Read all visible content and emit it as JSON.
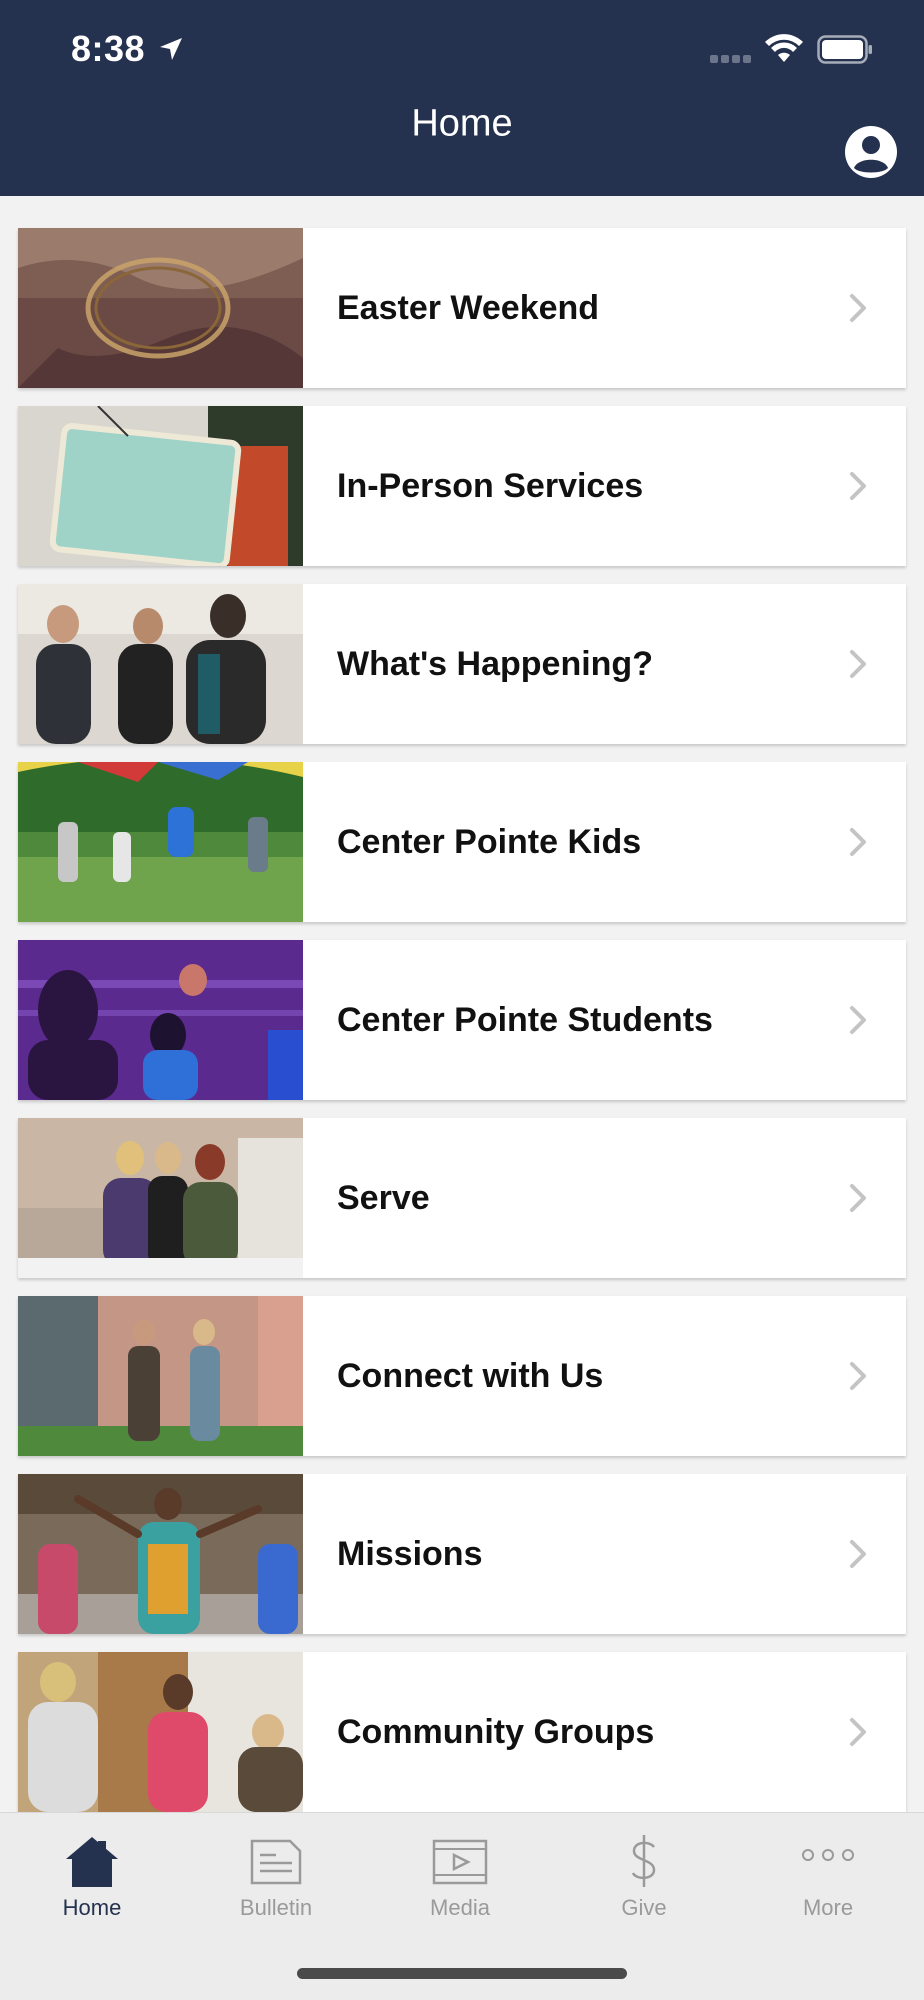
{
  "status_bar": {
    "time": "8:38"
  },
  "header": {
    "title": "Home"
  },
  "colors": {
    "header_bg": "#25324f",
    "tab_active": "#25324f",
    "tab_inactive": "#9a9a9a"
  },
  "list": {
    "items": [
      {
        "label": "Easter Weekend",
        "image": "crown-of-thorns-photo"
      },
      {
        "label": "In-Person Services",
        "image": "open-sign-photo"
      },
      {
        "label": "What's Happening?",
        "image": "women-laughing-photo"
      },
      {
        "label": "Center Pointe Kids",
        "image": "kids-parachute-photo"
      },
      {
        "label": "Center Pointe Students",
        "image": "worship-concert-photo"
      },
      {
        "label": "Serve",
        "image": "volunteers-photo"
      },
      {
        "label": "Connect with Us",
        "image": "church-entrance-photo"
      },
      {
        "label": "Missions",
        "image": "missions-dancing-photo"
      },
      {
        "label": "Community Groups",
        "image": "group-laughing-photo"
      }
    ]
  },
  "tabbar": {
    "tabs": [
      {
        "label": "Home",
        "icon": "house-icon",
        "active": true
      },
      {
        "label": "Bulletin",
        "icon": "newspaper-icon",
        "active": false
      },
      {
        "label": "Media",
        "icon": "film-icon",
        "active": false
      },
      {
        "label": "Give",
        "icon": "dollar-icon",
        "active": false
      },
      {
        "label": "More",
        "icon": "more-dots-icon",
        "active": false
      }
    ]
  }
}
